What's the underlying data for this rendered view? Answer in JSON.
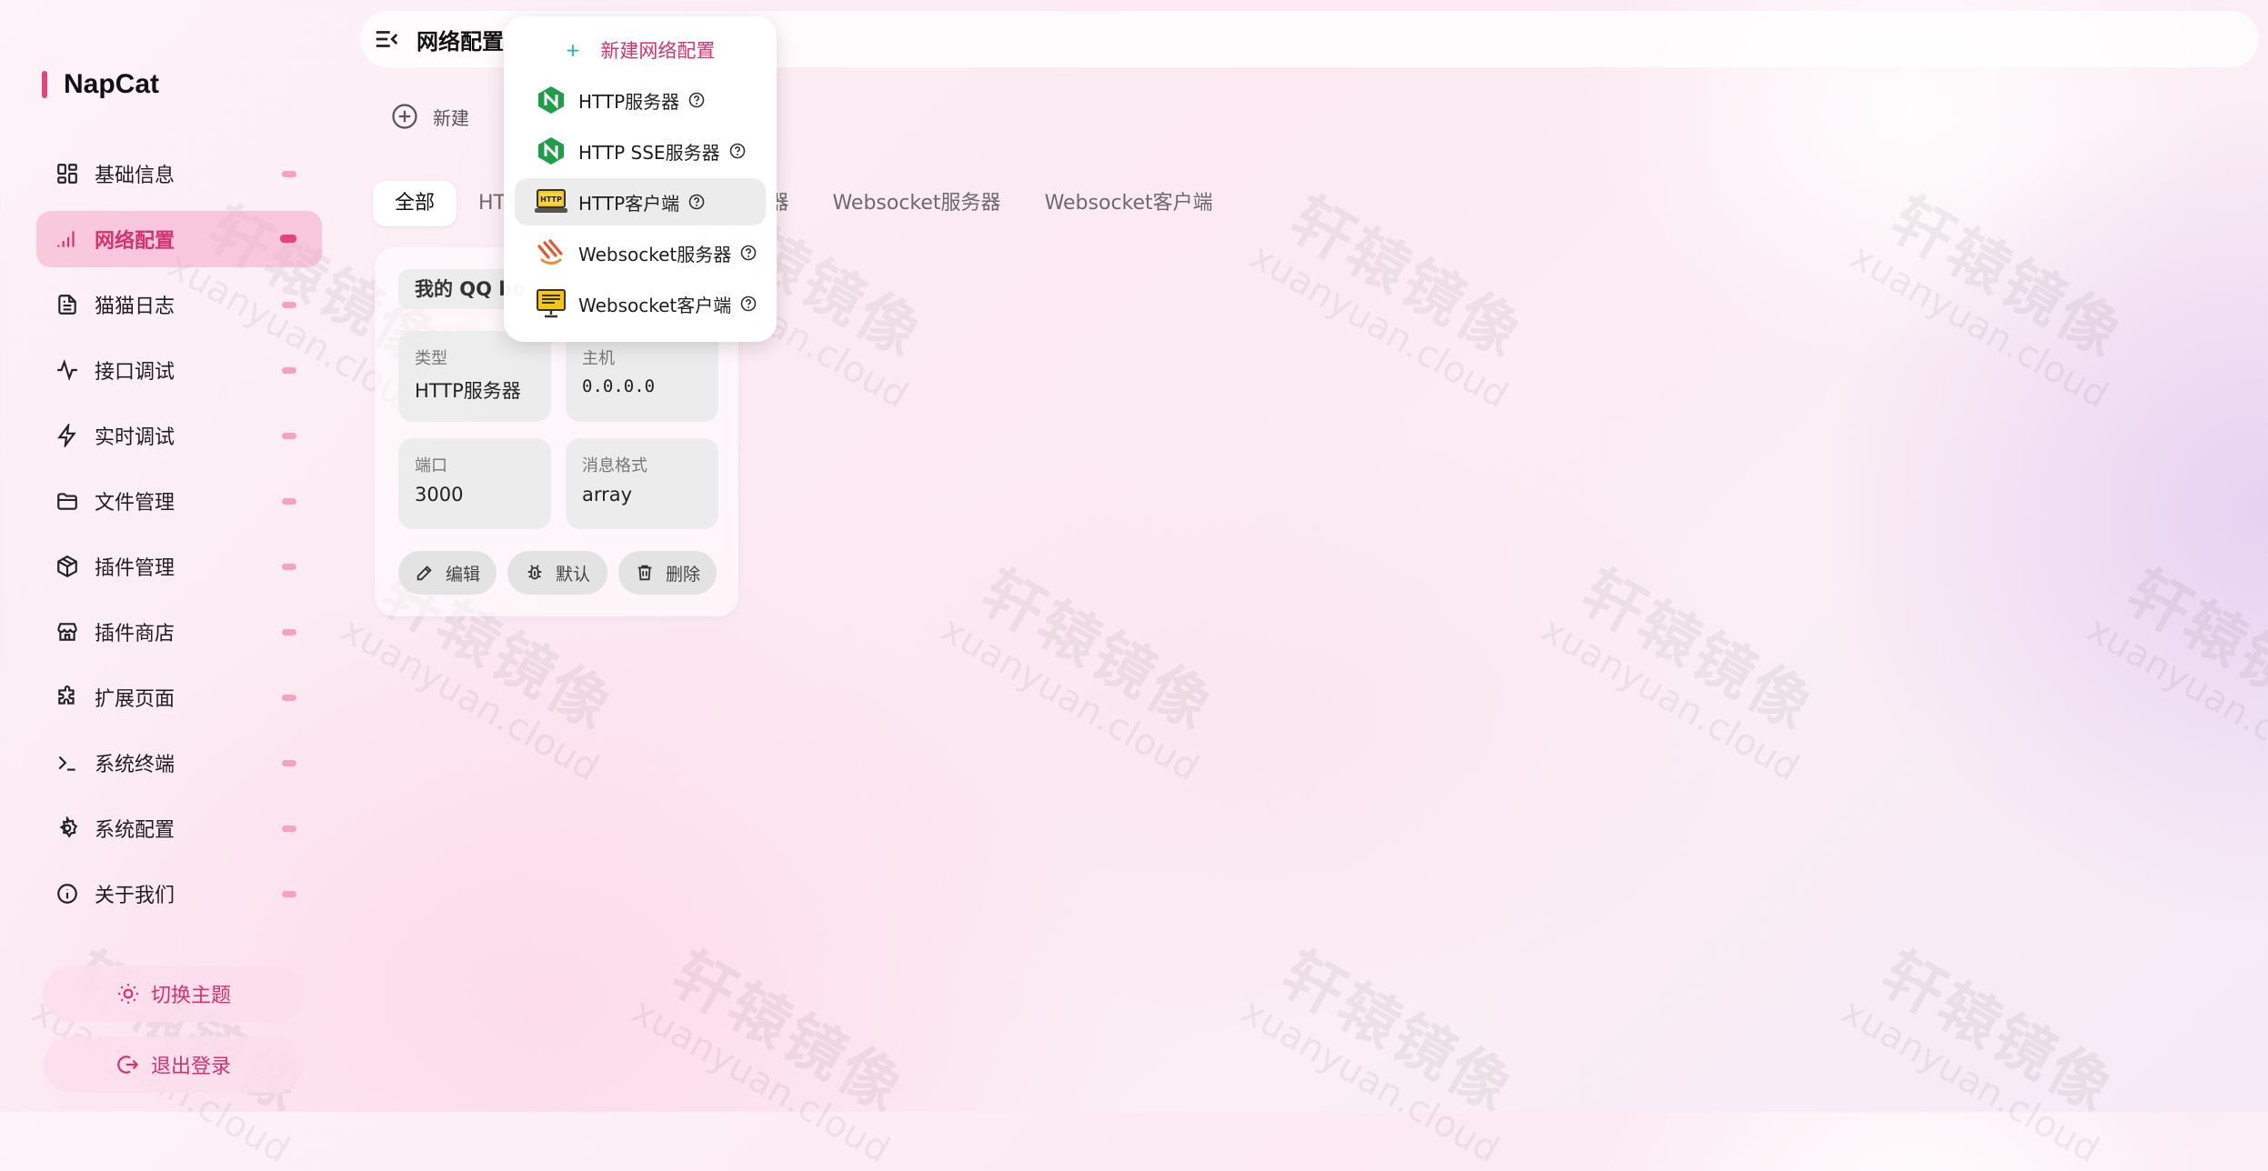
{
  "brand": {
    "name": "NapCat"
  },
  "sidebar": {
    "items": [
      {
        "label": "基础信息",
        "icon": "dashboard-icon",
        "active": false
      },
      {
        "label": "网络配置",
        "icon": "signal-icon",
        "active": true
      },
      {
        "label": "猫猫日志",
        "icon": "log-file-icon",
        "active": false
      },
      {
        "label": "接口调试",
        "icon": "pulse-icon",
        "active": false
      },
      {
        "label": "实时调试",
        "icon": "bolt-icon",
        "active": false
      },
      {
        "label": "文件管理",
        "icon": "folder-icon",
        "active": false
      },
      {
        "label": "插件管理",
        "icon": "package-icon",
        "active": false
      },
      {
        "label": "插件商店",
        "icon": "store-icon",
        "active": false
      },
      {
        "label": "扩展页面",
        "icon": "puzzle-icon",
        "active": false
      },
      {
        "label": "系统终端",
        "icon": "terminal-icon",
        "active": false
      },
      {
        "label": "系统配置",
        "icon": "gear-icon",
        "active": false
      },
      {
        "label": "关于我们",
        "icon": "info-icon",
        "active": false
      }
    ],
    "theme_label": "切换主题",
    "logout_label": "退出登录"
  },
  "header": {
    "title": "网络配置"
  },
  "toolbar": {
    "new_label": "新建"
  },
  "tabs": [
    {
      "label": "全部",
      "active": true
    },
    {
      "label": "HTTP服务器",
      "active": false
    },
    {
      "label": "HTTP SSE服务器",
      "active": false
    },
    {
      "label": "Websocket服务器",
      "active": false
    },
    {
      "label": "Websocket客户端",
      "active": false
    }
  ],
  "card": {
    "name": "我的 QQ bot",
    "fields": [
      {
        "key": "类型",
        "value": "HTTP服务器"
      },
      {
        "key": "主机",
        "value": "0.0.0.0"
      },
      {
        "key": "端口",
        "value": "3000"
      },
      {
        "key": "消息格式",
        "value": "array"
      }
    ],
    "edit_label": "编辑",
    "default_label": "默认",
    "delete_label": "删除"
  },
  "dropdown": {
    "header": "新建网络配置",
    "items": [
      {
        "label": "HTTP服务器",
        "icon": "nginx-icon"
      },
      {
        "label": "HTTP SSE服务器",
        "icon": "nginx-icon"
      },
      {
        "label": "HTTP客户端",
        "icon": "http-laptop-icon",
        "hover": true
      },
      {
        "label": "Websocket服务器",
        "icon": "websocket-server-icon"
      },
      {
        "label": "Websocket客户端",
        "icon": "websocket-client-icon"
      }
    ]
  },
  "watermark": {
    "cn": "轩辕镜像",
    "en": "xuanyuan.cloud"
  },
  "colors": {
    "accent": "#d6336c",
    "accent_soft": "#f3a2c0",
    "active_bg": "#f4a5c8"
  }
}
